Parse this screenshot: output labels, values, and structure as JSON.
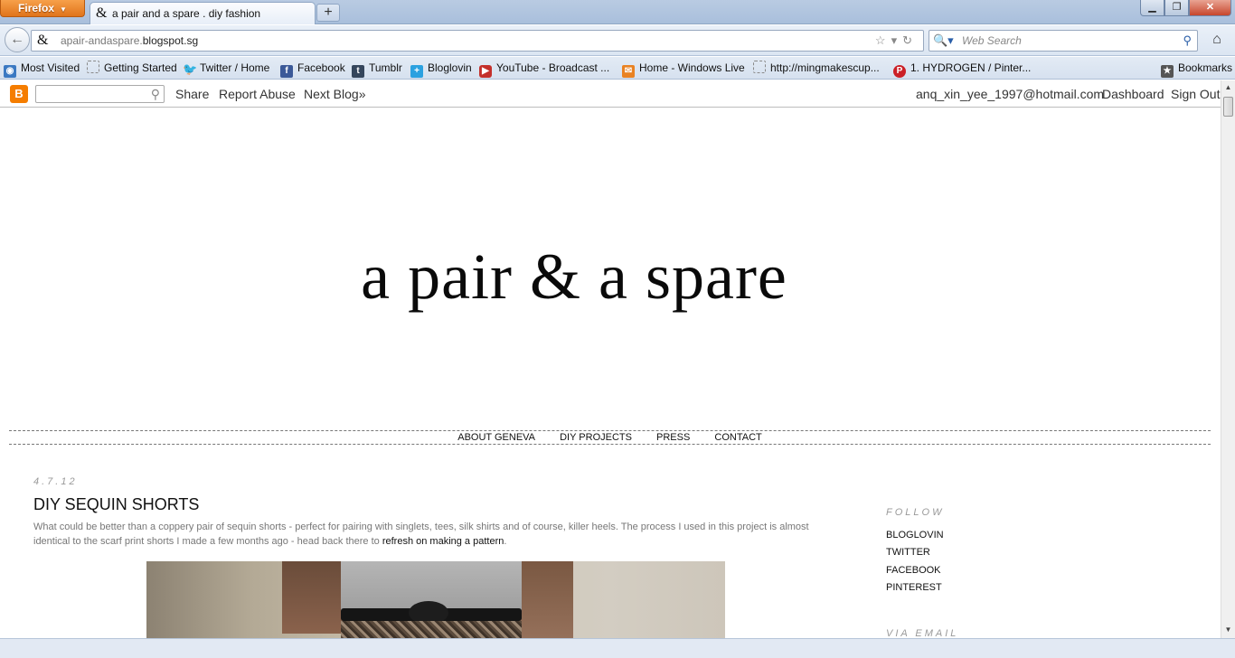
{
  "browser": {
    "menu_button": "Firefox",
    "tab_title": "a pair and a spare . diy fashion",
    "new_tab": "+",
    "url_host_prefix": "apair-andaspare.",
    "url_host_main": "blogspot.sg",
    "search_placeholder": "Web Search"
  },
  "bookmarks": [
    {
      "label": "Most Visited",
      "icon": "rss-icon"
    },
    {
      "label": "Getting Started",
      "icon": "blank-page-icon"
    },
    {
      "label": "Twitter / Home",
      "icon": "twitter-icon"
    },
    {
      "label": "Facebook",
      "icon": "facebook-icon"
    },
    {
      "label": "Tumblr",
      "icon": "tumblr-icon"
    },
    {
      "label": "Bloglovin",
      "icon": "bloglovin-icon"
    },
    {
      "label": "YouTube - Broadcast ...",
      "icon": "youtube-icon"
    },
    {
      "label": "Home - Windows Live",
      "icon": "windows-live-icon"
    },
    {
      "label": "http://mingmakescup...",
      "icon": "blank-page-icon"
    },
    {
      "label": "1. HYDROGEN / Pinter...",
      "icon": "pinterest-icon"
    },
    {
      "label": "Bookmarks",
      "icon": "star-icon"
    }
  ],
  "blogger_bar": {
    "share": "Share",
    "report_abuse": "Report Abuse",
    "next_blog": "Next Blog»",
    "email": "anq_xin_yee_1997@hotmail.com",
    "dashboard": "Dashboard",
    "sign_out": "Sign Out"
  },
  "blog": {
    "title": "a pair & a spare",
    "menu": [
      "ABOUT GENEVA",
      "DIY PROJECTS",
      "PRESS",
      "CONTACT"
    ]
  },
  "post": {
    "date": "4.7.12",
    "title": "DIY SEQUIN SHORTS",
    "body": "What could be better than a coppery pair of sequin shorts - perfect for pairing with singlets, tees, silk shirts and of course, killer heels. The process I used in this project is almost identical to the scarf print shorts I made a few months ago - head back there to ",
    "link_text": "refresh on making a pattern",
    "body_end": "."
  },
  "sidebar": {
    "follow_heading": "FOLLOW",
    "follow_links": [
      "BLOGLOVIN",
      "TWITTER",
      "FACEBOOK",
      "PINTEREST"
    ],
    "via_email_heading": "VIA EMAIL"
  }
}
